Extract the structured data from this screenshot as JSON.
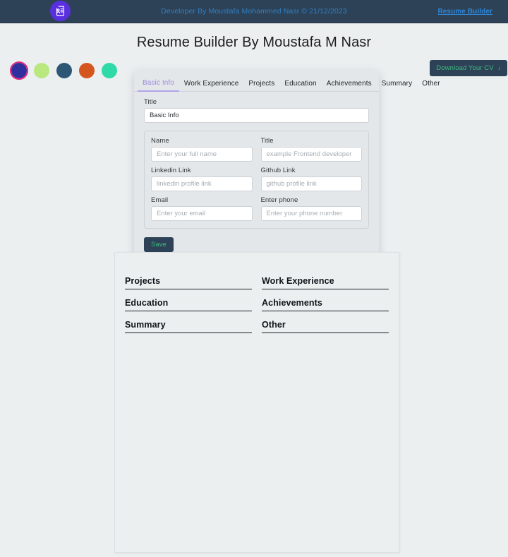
{
  "navbar": {
    "logo_icon": "resume-document-icon",
    "center_text": "Developer By Moustafa Mohammed Nasr © 21/12/2023",
    "brand_link": "Resume Builder",
    "bg_color": "#2d4257",
    "link_color": "#2f86d6"
  },
  "header": {
    "page_title": "Resume Builder By Moustafa M Nasr"
  },
  "theme": {
    "swatches": [
      {
        "name": "indigo",
        "color": "#2f2f9e",
        "selected": true
      },
      {
        "name": "light-green",
        "color": "#b9e87e",
        "selected": false
      },
      {
        "name": "steel-blue",
        "color": "#2d5775",
        "selected": false
      },
      {
        "name": "orange",
        "color": "#d5551f",
        "selected": false
      },
      {
        "name": "mint",
        "color": "#2fdaa8",
        "selected": false
      }
    ],
    "download_label": "Download Your CV",
    "download_icon": "arrow-down-icon",
    "download_text_color": "#3fb980",
    "download_bg_color": "#2d4257"
  },
  "form": {
    "tabs": [
      {
        "label": "Basic Info",
        "active": true
      },
      {
        "label": "Work Experience",
        "active": false
      },
      {
        "label": "Projects",
        "active": false
      },
      {
        "label": "Education",
        "active": false
      },
      {
        "label": "Achievements",
        "active": false
      },
      {
        "label": "Summary",
        "active": false
      },
      {
        "label": "Other",
        "active": false
      }
    ],
    "active_tab_color": "#9c8ce0",
    "title_field": {
      "label": "Title",
      "value": "Basic Info",
      "placeholder": "Title"
    },
    "fields": [
      {
        "label": "Name",
        "placeholder": "Enter your full name",
        "value": ""
      },
      {
        "label": "Title",
        "placeholder": "example Frontend developer",
        "value": ""
      },
      {
        "label": "Linkedin Link",
        "placeholder": "linkedin profile link",
        "value": ""
      },
      {
        "label": "Github Link",
        "placeholder": "github profile link",
        "value": ""
      },
      {
        "label": "Email",
        "placeholder": "Enter your email",
        "value": ""
      },
      {
        "label": "Enter phone",
        "placeholder": "Enter your phone number",
        "value": ""
      }
    ],
    "save_label": "Save"
  },
  "preview": {
    "sections": [
      "Projects",
      "Work Experience",
      "Education",
      "Achievements",
      "Summary",
      "Other"
    ]
  }
}
